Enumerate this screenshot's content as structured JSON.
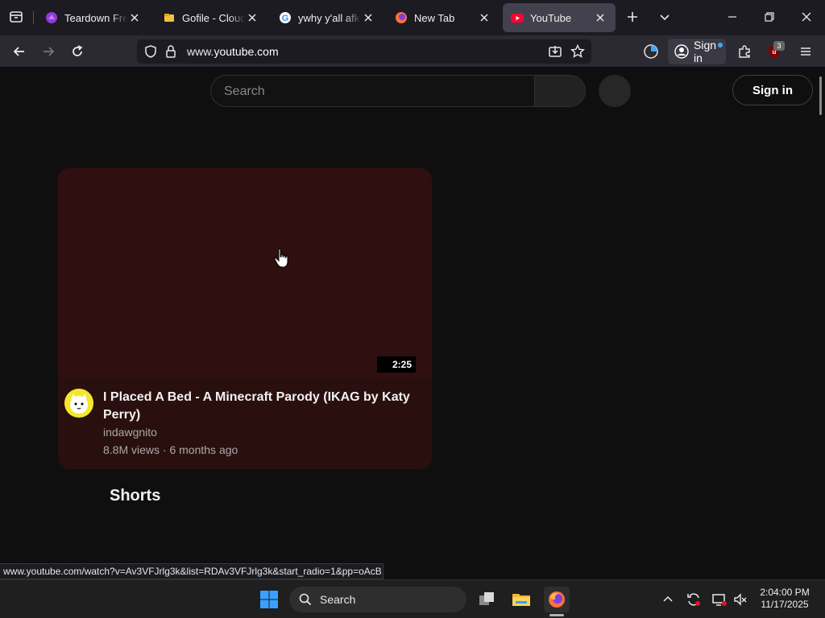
{
  "browser": {
    "tabs": [
      {
        "title": "Teardown Free D",
        "favicon": "teardown-favicon",
        "active": false
      },
      {
        "title": "Gofile - Cloud St",
        "favicon": "gofile-favicon",
        "active": false
      },
      {
        "title": "ywhy y'all afk - G",
        "favicon": "google-favicon",
        "active": false
      },
      {
        "title": "New Tab",
        "favicon": "firefox-favicon",
        "active": false
      },
      {
        "title": "YouTube",
        "favicon": "youtube-favicon",
        "active": true
      }
    ],
    "url_host": "www.",
    "url_domain": "youtube.com",
    "signin_label": "Sign in",
    "extension_badge": "3"
  },
  "youtube": {
    "search_placeholder": "Search",
    "signin_label": "Sign in",
    "video": {
      "title": "I Placed A Bed - A Minecraft Parody (IKAG by Katy Perry)",
      "channel": "indawgnito",
      "meta": "8.8M views · 6 months ago",
      "duration": "2:25"
    },
    "shorts_heading": "Shorts"
  },
  "status_link": "www.youtube.com/watch?v=Av3VFJrlg3k&list=RDAv3VFJrlg3k&start_radio=1&pp=oAcB",
  "taskbar": {
    "search_label": "Search",
    "time": "2:04:00 PM",
    "date": "11/17/2025"
  },
  "colors": {
    "youtube_red": "#ff0033",
    "card_bg": "#2a0f0f",
    "active_tab": "#42414d"
  }
}
